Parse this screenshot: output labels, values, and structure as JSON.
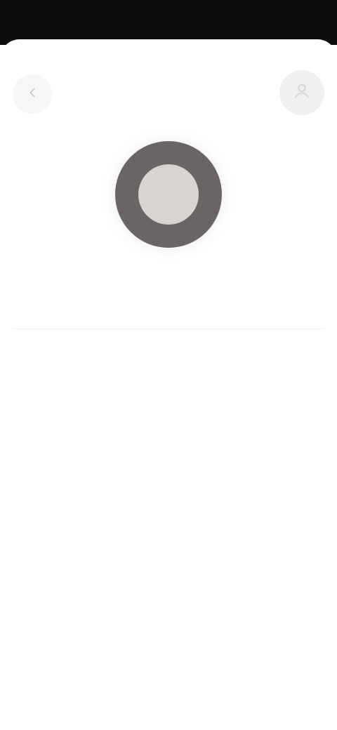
{
  "status_bar": {
    "left_text": "",
    "right_text": ""
  },
  "header": {
    "title": ""
  },
  "icons": {
    "back": "back-icon",
    "profile": "profile-icon"
  },
  "record": {
    "label": ""
  },
  "list": {
    "items": [
      {
        "title": "",
        "meta": ""
      }
    ]
  },
  "colors": {
    "status_bar_bg": "#0c0c0c",
    "record_outer": "#6a6464",
    "record_inner": "#d9d3d2",
    "background": "#ffffff"
  }
}
